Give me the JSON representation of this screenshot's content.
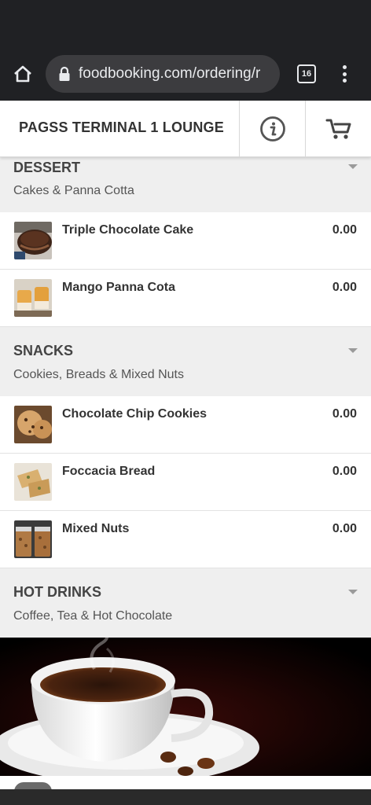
{
  "browser": {
    "url": "foodbooking.com/ordering/r",
    "tab_count": "16"
  },
  "header": {
    "title": "PAGSS TERMINAL 1 LOUNGE"
  },
  "sections": [
    {
      "title": "DESSERT",
      "subtitle": "Cakes & Panna Cotta",
      "items": [
        {
          "name": "Triple Chocolate Cake",
          "price": "0.00"
        },
        {
          "name": "Mango Panna Cota",
          "price": "0.00"
        }
      ]
    },
    {
      "title": "SNACKS",
      "subtitle": "Cookies, Breads & Mixed Nuts",
      "items": [
        {
          "name": "Chocolate Chip Cookies",
          "price": "0.00"
        },
        {
          "name": "Foccacia Bread",
          "price": "0.00"
        },
        {
          "name": "Mixed Nuts",
          "price": "0.00"
        }
      ]
    },
    {
      "title": "HOT DRINKS",
      "subtitle": "Coffee, Tea & Hot Chocolate",
      "items": []
    }
  ],
  "colors": {
    "browser_chrome": "#202124",
    "section_background": "#efefef",
    "text_dark": "#333333"
  }
}
